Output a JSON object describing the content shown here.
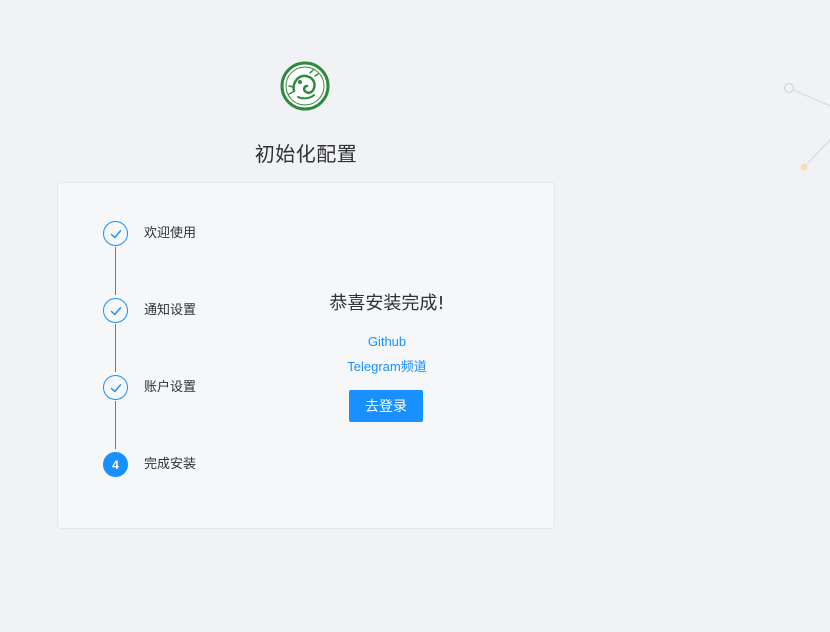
{
  "header": {
    "logo_icon": "dragon-emblem-icon",
    "title": "初始化配置"
  },
  "steps": {
    "items": [
      {
        "label": "欢迎使用",
        "status": "finished",
        "icon": "check-icon"
      },
      {
        "label": "通知设置",
        "status": "finished",
        "icon": "check-icon"
      },
      {
        "label": "账户设置",
        "status": "finished",
        "icon": "check-icon"
      },
      {
        "label": "完成安装",
        "status": "active",
        "number": "4"
      }
    ]
  },
  "content": {
    "title": "恭喜安装完成!",
    "links": [
      {
        "label": "Github"
      },
      {
        "label": "Telegram频道"
      }
    ],
    "login_button_label": "去登录"
  },
  "colors": {
    "accent": "#1890ff",
    "background": "#f0f2f5",
    "card": "#f5f7f9",
    "logo": "#2e8b3e"
  }
}
